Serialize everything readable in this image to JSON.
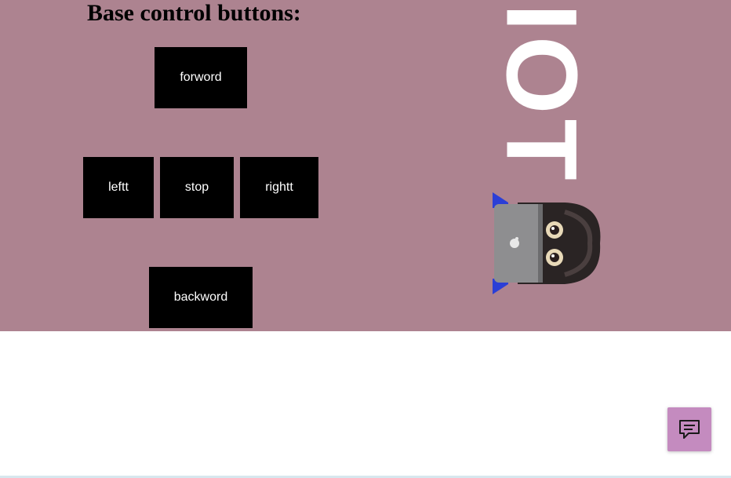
{
  "heading": "Base control buttons:",
  "controls": {
    "forward": "forword",
    "left": "leftt",
    "stop": "stop",
    "right": "rightt",
    "backward": "backword"
  },
  "hero": {
    "background_color": "#ad8390",
    "rotated_text": "IOT"
  },
  "chat": {
    "icon": "chat-icon",
    "color": "#c48bbf"
  }
}
